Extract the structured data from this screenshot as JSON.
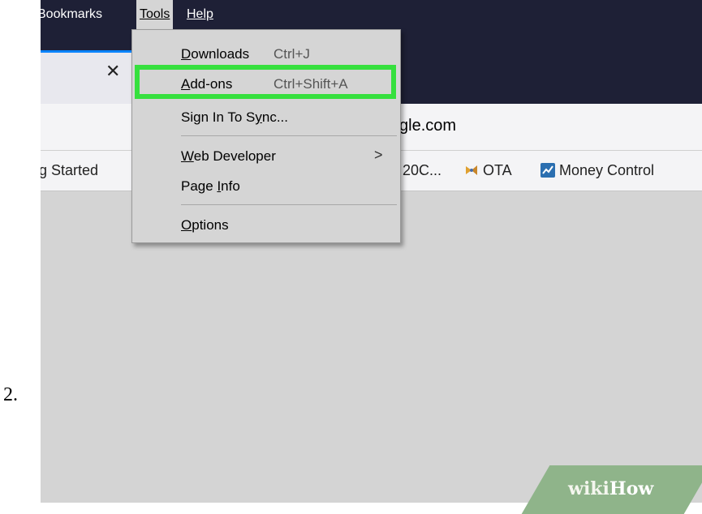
{
  "step_number": "2.",
  "menubar": {
    "bookmarks": "Bookmarks",
    "tools": "Tools",
    "help": "Help"
  },
  "tab": {
    "close_glyph": "✕"
  },
  "navbar": {
    "url_fragment": "gle.com"
  },
  "bookmarks_bar": {
    "items": [
      {
        "label": "ng Started"
      },
      {
        "label": "20C..."
      },
      {
        "label": "OTA",
        "icon": "ota-bookmark-icon"
      },
      {
        "label": "Money Control",
        "icon": "money-control-icon"
      }
    ]
  },
  "tools_menu": {
    "items": [
      {
        "label": "Downloads",
        "shortcut": "Ctrl+J"
      },
      {
        "label": "Add-ons",
        "shortcut": "Ctrl+Shift+A",
        "highlighted": true
      },
      {
        "label": "Sign In To Sync..."
      },
      {
        "label": "Web Developer",
        "submenu_arrow": ">"
      },
      {
        "label": "Page Info"
      },
      {
        "label": "Options"
      }
    ]
  },
  "colors": {
    "titlebar": "#1e2036",
    "menu_background": "#d5d5d5",
    "highlight_border": "#36e03e",
    "content_background": "#d4d4d4"
  },
  "watermark": {
    "wiki": "wiki",
    "how": "How"
  }
}
